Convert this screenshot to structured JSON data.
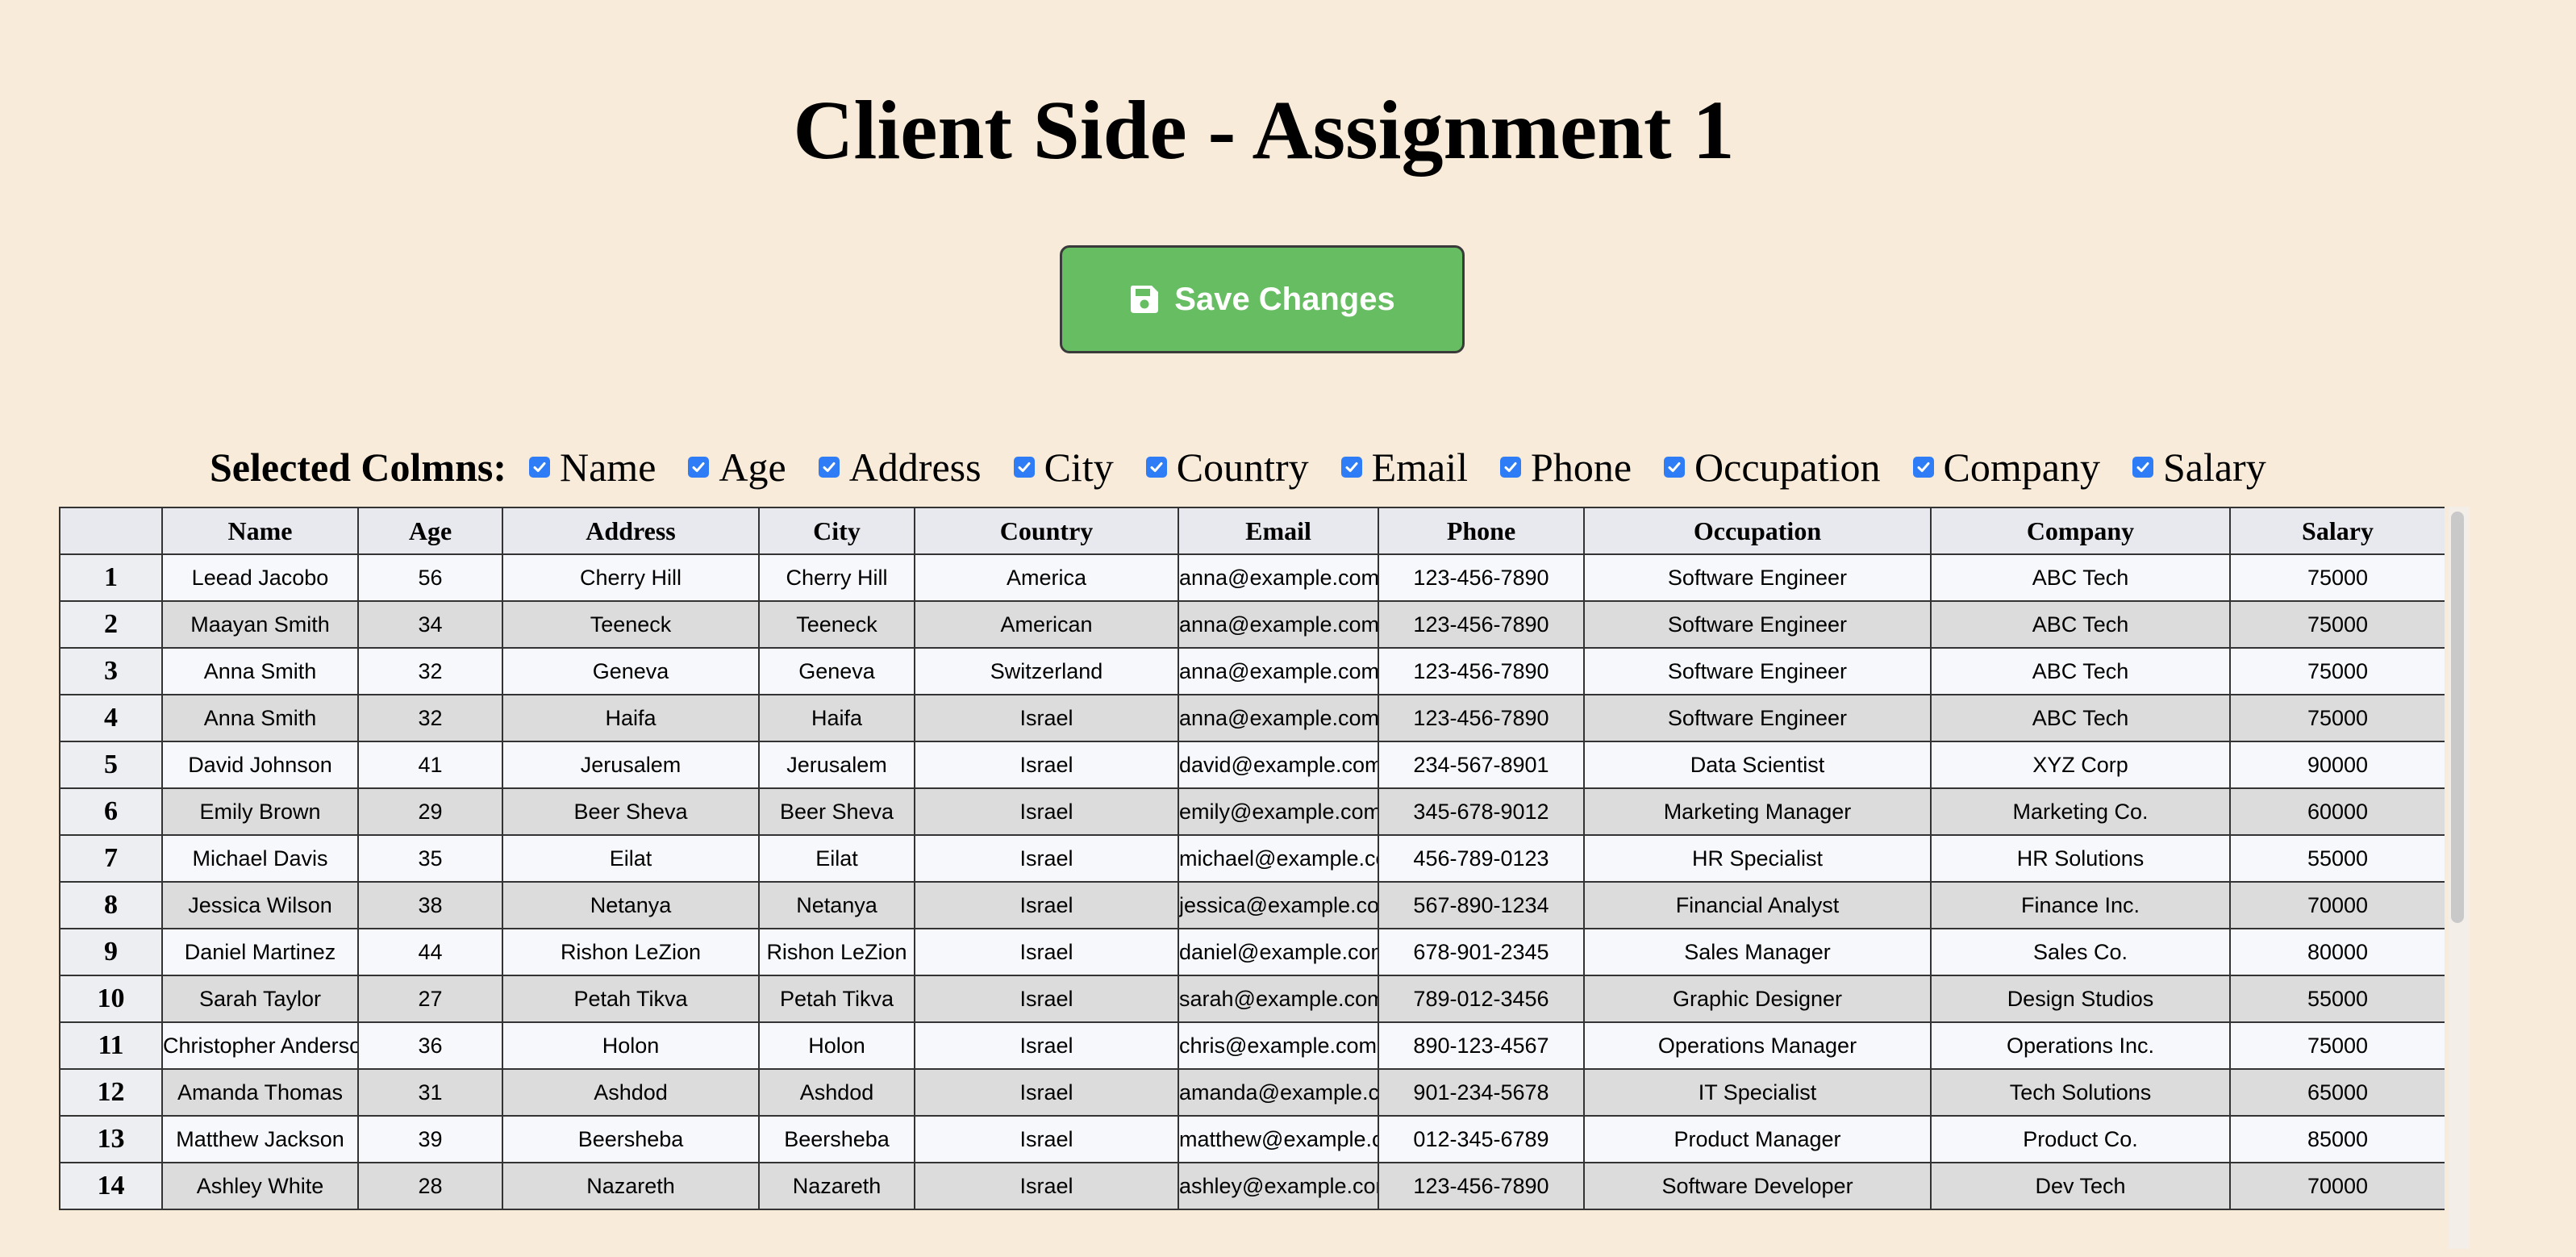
{
  "page": {
    "title": "Client Side - Assignment 1"
  },
  "toolbar": {
    "save_label": "Save Changes",
    "save_icon": "floppy-disk-icon"
  },
  "column_selector": {
    "label": "Selected Colmns:",
    "options": [
      {
        "label": "Name",
        "checked": true
      },
      {
        "label": "Age",
        "checked": true
      },
      {
        "label": "Address",
        "checked": true
      },
      {
        "label": "City",
        "checked": true
      },
      {
        "label": "Country",
        "checked": true
      },
      {
        "label": "Email",
        "checked": true
      },
      {
        "label": "Phone",
        "checked": true
      },
      {
        "label": "Occupation",
        "checked": true
      },
      {
        "label": "Company",
        "checked": true
      },
      {
        "label": "Salary",
        "checked": true
      }
    ]
  },
  "table": {
    "headers": [
      "",
      "Name",
      "Age",
      "Address",
      "City",
      "Country",
      "Email",
      "Phone",
      "Occupation",
      "Company",
      "Salary"
    ],
    "rows": [
      {
        "num": "1",
        "cells": [
          "Leead Jacobo",
          "56",
          "Cherry Hill",
          "Cherry Hill",
          "America",
          "anna@example.com",
          "123-456-7890",
          "Software Engineer",
          "ABC Tech",
          "75000"
        ]
      },
      {
        "num": "2",
        "cells": [
          "Maayan Smith",
          "34",
          "Teeneck",
          "Teeneck",
          "American",
          "anna@example.com",
          "123-456-7890",
          "Software Engineer",
          "ABC Tech",
          "75000"
        ]
      },
      {
        "num": "3",
        "cells": [
          "Anna Smith",
          "32",
          "Geneva",
          "Geneva",
          "Switzerland",
          "anna@example.com",
          "123-456-7890",
          "Software Engineer",
          "ABC Tech",
          "75000"
        ]
      },
      {
        "num": "4",
        "cells": [
          "Anna Smith",
          "32",
          "Haifa",
          "Haifa",
          "Israel",
          "anna@example.com",
          "123-456-7890",
          "Software Engineer",
          "ABC Tech",
          "75000"
        ]
      },
      {
        "num": "5",
        "cells": [
          "David Johnson",
          "41",
          "Jerusalem",
          "Jerusalem",
          "Israel",
          "david@example.com",
          "234-567-8901",
          "Data Scientist",
          "XYZ Corp",
          "90000"
        ]
      },
      {
        "num": "6",
        "cells": [
          "Emily Brown",
          "29",
          "Beer Sheva",
          "Beer Sheva",
          "Israel",
          "emily@example.com",
          "345-678-9012",
          "Marketing Manager",
          "Marketing Co.",
          "60000"
        ]
      },
      {
        "num": "7",
        "cells": [
          "Michael Davis",
          "35",
          "Eilat",
          "Eilat",
          "Israel",
          "michael@example.com",
          "456-789-0123",
          "HR Specialist",
          "HR Solutions",
          "55000"
        ]
      },
      {
        "num": "8",
        "cells": [
          "Jessica Wilson",
          "38",
          "Netanya",
          "Netanya",
          "Israel",
          "jessica@example.com",
          "567-890-1234",
          "Financial Analyst",
          "Finance Inc.",
          "70000"
        ]
      },
      {
        "num": "9",
        "cells": [
          "Daniel Martinez",
          "44",
          "Rishon LeZion",
          "Rishon LeZion",
          "Israel",
          "daniel@example.com",
          "678-901-2345",
          "Sales Manager",
          "Sales Co.",
          "80000"
        ]
      },
      {
        "num": "10",
        "cells": [
          "Sarah Taylor",
          "27",
          "Petah Tikva",
          "Petah Tikva",
          "Israel",
          "sarah@example.com",
          "789-012-3456",
          "Graphic Designer",
          "Design Studios",
          "55000"
        ]
      },
      {
        "num": "11",
        "cells": [
          "Christopher Anderson",
          "36",
          "Holon",
          "Holon",
          "Israel",
          "chris@example.com",
          "890-123-4567",
          "Operations Manager",
          "Operations Inc.",
          "75000"
        ]
      },
      {
        "num": "12",
        "cells": [
          "Amanda Thomas",
          "31",
          "Ashdod",
          "Ashdod",
          "Israel",
          "amanda@example.com",
          "901-234-5678",
          "IT Specialist",
          "Tech Solutions",
          "65000"
        ]
      },
      {
        "num": "13",
        "cells": [
          "Matthew Jackson",
          "39",
          "Beersheba",
          "Beersheba",
          "Israel",
          "matthew@example.com",
          "012-345-6789",
          "Product Manager",
          "Product Co.",
          "85000"
        ]
      },
      {
        "num": "14",
        "cells": [
          "Ashley White",
          "28",
          "Nazareth",
          "Nazareth",
          "Israel",
          "ashley@example.com",
          "123-456-7890",
          "Software Developer",
          "Dev Tech",
          "70000"
        ]
      }
    ]
  },
  "colors": {
    "background": "#f8ebd9",
    "save_button": "#67bd62",
    "checkbox": "#2f7df6",
    "row_even": "#dcdcdc",
    "row_odd": "#f7f8fb",
    "header": "#e8e9ee"
  }
}
